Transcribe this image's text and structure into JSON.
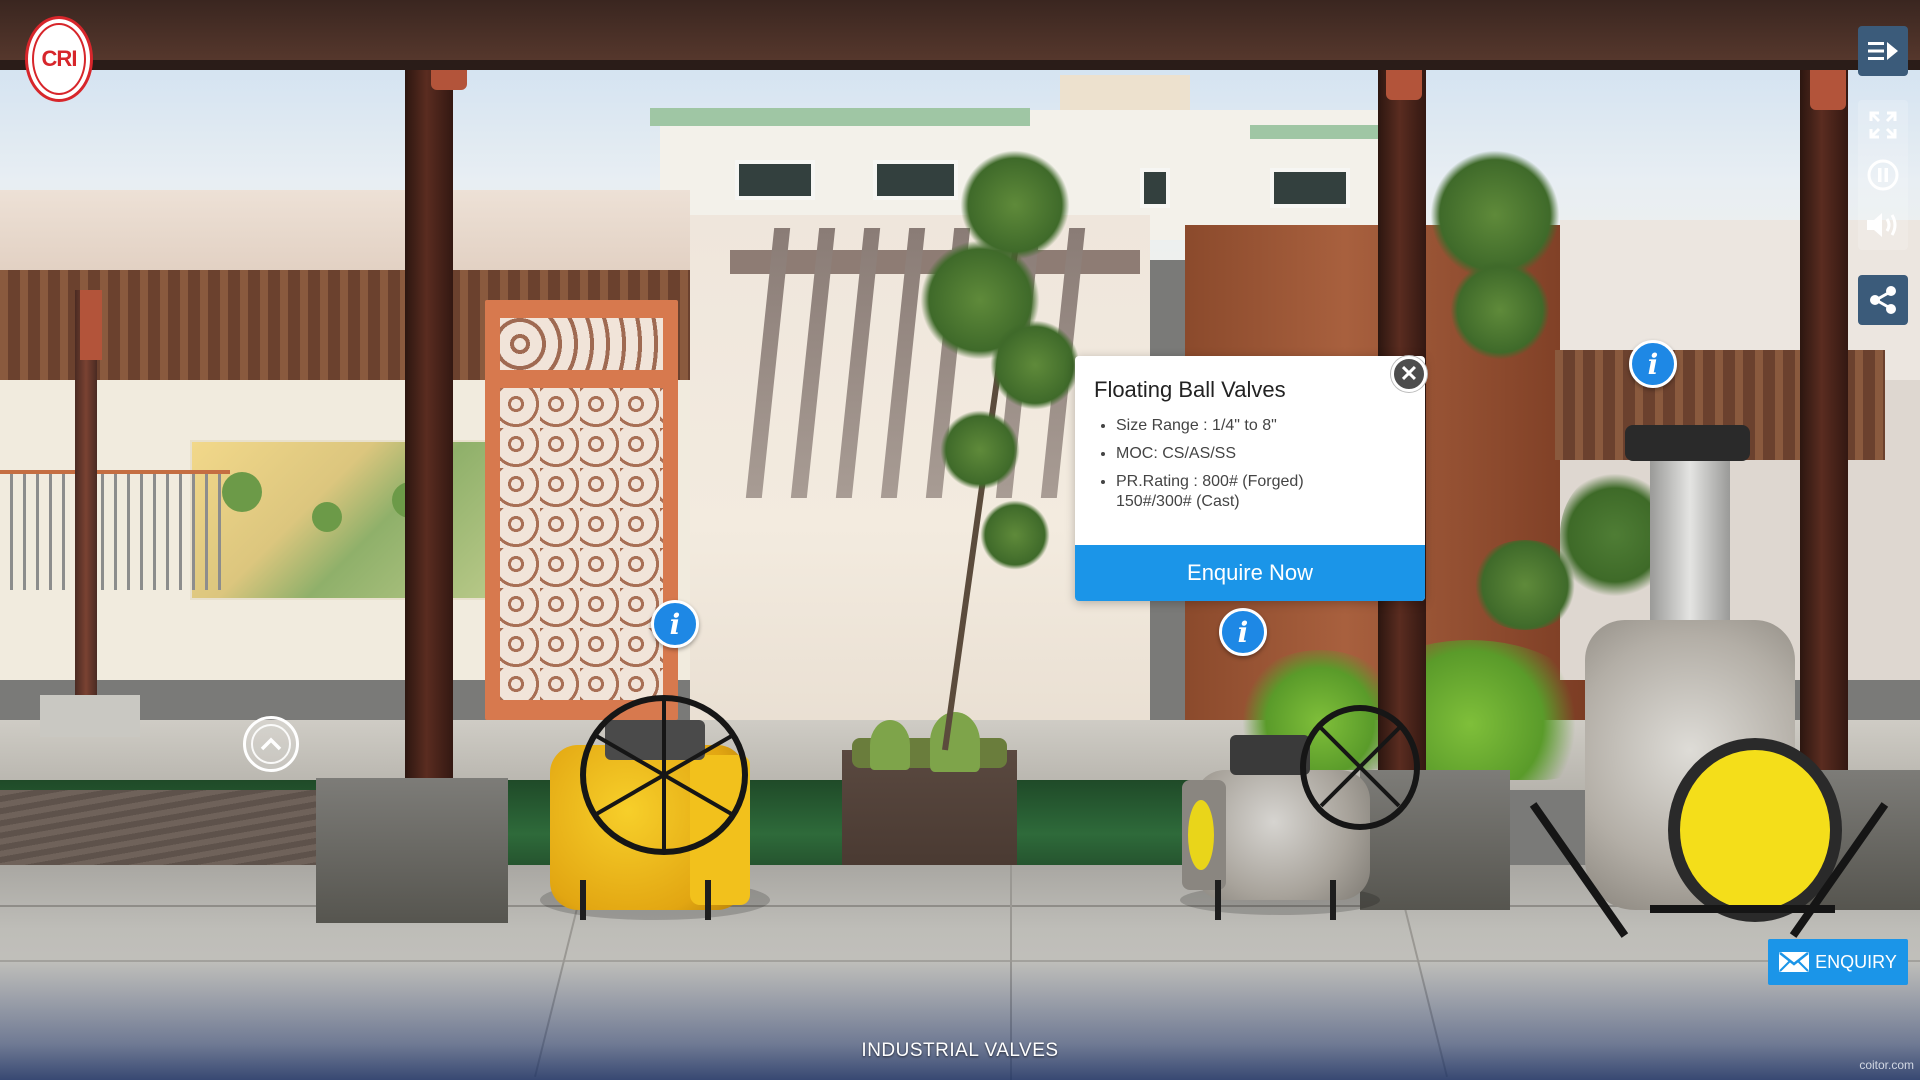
{
  "logo": {
    "text": "CRI"
  },
  "controls": {
    "menu_icon": "menu-collapse-icon",
    "fullscreen_icon": "fullscreen-icon",
    "pause_icon": "pause-icon",
    "sound_icon": "volume-icon",
    "share_icon": "share-icon"
  },
  "hotspots": {
    "info_glyph": "i",
    "nav_icon": "chevron-up-icon"
  },
  "popup": {
    "title": "Floating Ball Valves",
    "items": [
      "Size Range : 1/4\" to 8\"",
      "MOC: CS/AS/SS",
      "PR.Rating : 800# (Forged)",
      "150#/300# (Cast)"
    ],
    "close_glyph": "✕",
    "button_label": "Enquire Now"
  },
  "enquiry": {
    "label": "ENQUIRY",
    "icon": "mail-icon"
  },
  "caption": "INDUSTRIAL VALVES",
  "credit": "coitor.com",
  "colors": {
    "accent_blue": "#1b95e8",
    "control_blue": "#3b5b7a",
    "brand_red": "#d7262b"
  }
}
